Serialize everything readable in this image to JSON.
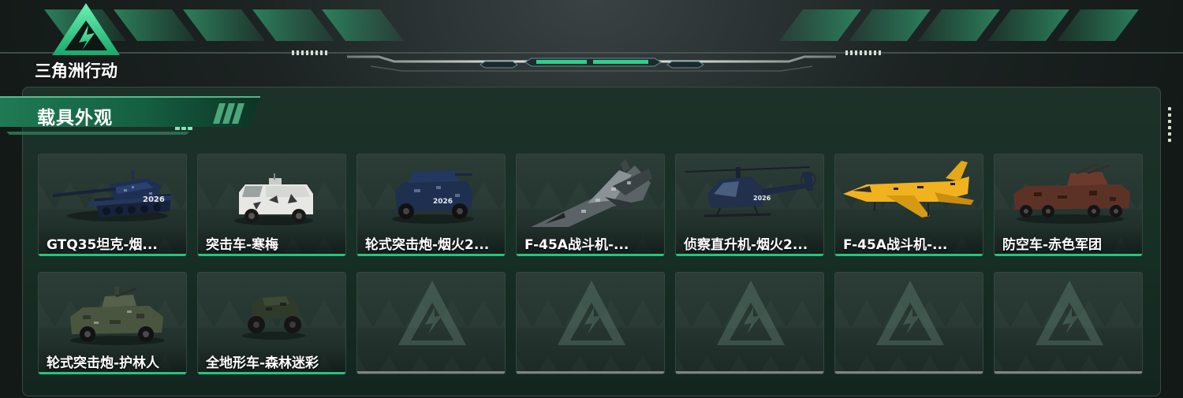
{
  "game": {
    "logo_text": "三角洲行动"
  },
  "section": {
    "title": "载具外观"
  },
  "vehicles": [
    {
      "label": "GTQ35坦克-烟...",
      "icon": "tank-icon",
      "state": "owned"
    },
    {
      "label": "突击车-寒梅",
      "icon": "armored-car-icon",
      "state": "owned"
    },
    {
      "label": "轮式突击炮-烟火2...",
      "icon": "armored-car-icon",
      "state": "owned"
    },
    {
      "label": "F-45A战斗机-...",
      "icon": "fighter-jet-icon",
      "state": "owned"
    },
    {
      "label": "侦察直升机-烟火2...",
      "icon": "helicopter-icon",
      "state": "owned"
    },
    {
      "label": "F-45A战斗机-...",
      "icon": "fighter-jet-icon",
      "state": "owned"
    },
    {
      "label": "防空车-赤色军团",
      "icon": "aa-vehicle-icon",
      "state": "owned"
    },
    {
      "label": "轮式突击炮-护林人",
      "icon": "armored-car-icon",
      "state": "owned"
    },
    {
      "label": "全地形车-森林迷彩",
      "icon": "atv-icon",
      "state": "owned"
    },
    {
      "label": "",
      "icon": "empty-slot-emblem-icon",
      "state": "empty"
    },
    {
      "label": "",
      "icon": "empty-slot-emblem-icon",
      "state": "empty"
    },
    {
      "label": "",
      "icon": "empty-slot-emblem-icon",
      "state": "empty"
    },
    {
      "label": "",
      "icon": "empty-slot-emblem-icon",
      "state": "empty"
    },
    {
      "label": "",
      "icon": "empty-slot-emblem-icon",
      "state": "empty"
    }
  ],
  "colors": {
    "accent": "#27c47f",
    "empty_bar": "#7d8582",
    "panel": "#173026"
  }
}
